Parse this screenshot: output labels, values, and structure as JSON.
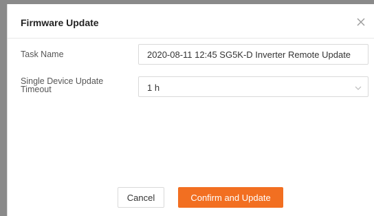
{
  "dialog": {
    "title": "Firmware Update",
    "close_icon": "close-icon"
  },
  "form": {
    "task_name_label": "Task Name",
    "task_name_value": "2020-08-11 12:45 SG5K-D Inverter Remote Update",
    "timeout_label_line1": "Single Device Update",
    "timeout_label_line2": "Timeout",
    "timeout_value": "1 h",
    "timeout_icon": "chevron-down-icon"
  },
  "footer": {
    "cancel_label": "Cancel",
    "confirm_label": "Confirm and Update"
  },
  "colors": {
    "accent": "#f26f21",
    "border": "#d9d9d9",
    "backdrop": "#8a8a8a"
  }
}
